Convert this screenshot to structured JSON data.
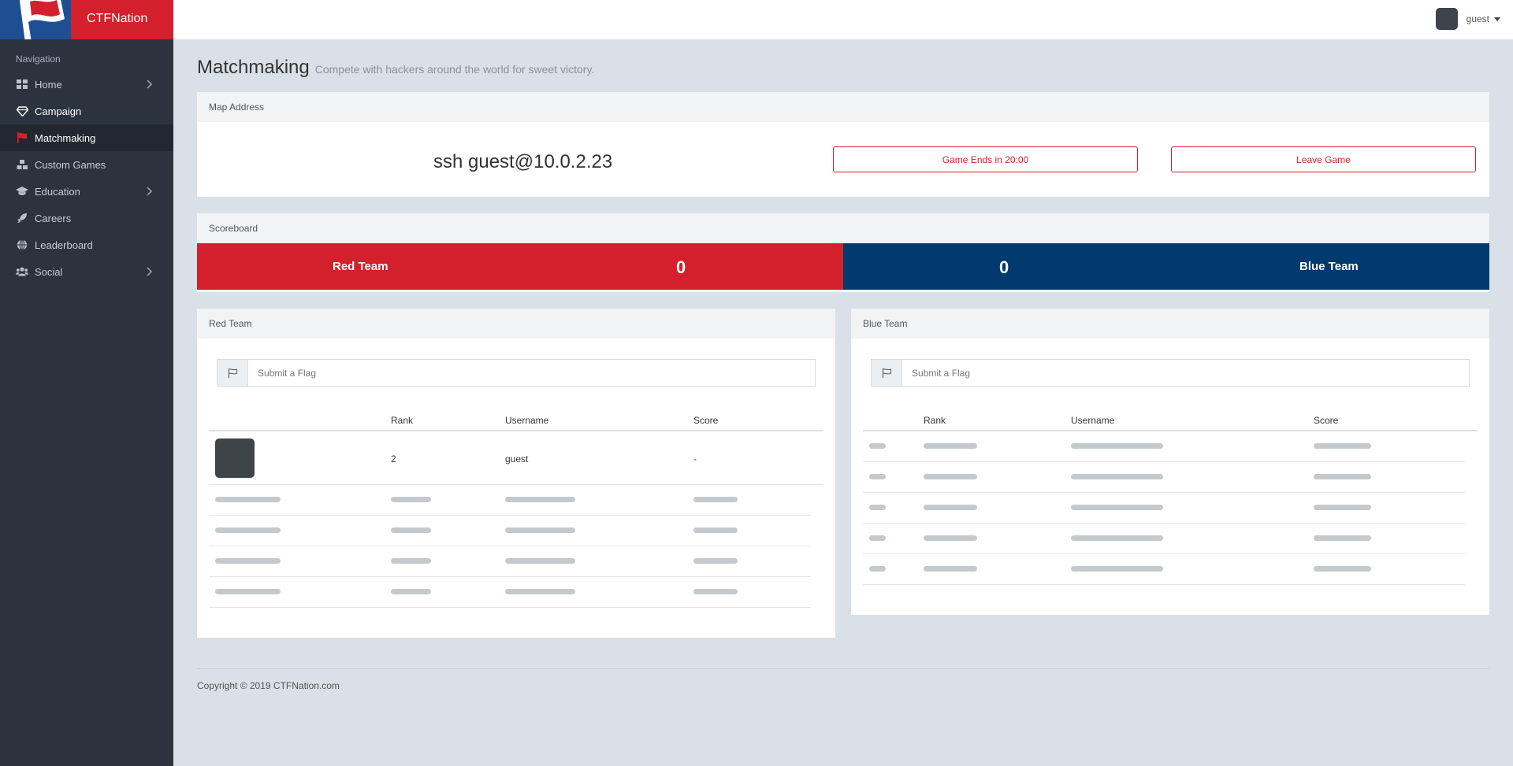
{
  "app": {
    "brand": "CTFNation"
  },
  "topbar": {
    "username": "guest"
  },
  "sidebar": {
    "heading": "Navigation",
    "items": [
      {
        "label": "Home",
        "icon": "grid-icon",
        "chevron": true
      },
      {
        "label": "Campaign",
        "icon": "diamond-icon",
        "chevron": false
      },
      {
        "label": "Matchmaking",
        "icon": "flag-icon",
        "chevron": false,
        "active": true
      },
      {
        "label": "Custom Games",
        "icon": "cubes-icon",
        "chevron": false
      },
      {
        "label": "Education",
        "icon": "graduation-cap-icon",
        "chevron": true
      },
      {
        "label": "Careers",
        "icon": "rocket-icon",
        "chevron": false
      },
      {
        "label": "Leaderboard",
        "icon": "globe-icon",
        "chevron": false
      },
      {
        "label": "Social",
        "icon": "users-icon",
        "chevron": true
      }
    ]
  },
  "page": {
    "title": "Matchmaking",
    "subtitle": "Compete with hackers around the world for sweet victory."
  },
  "map_panel": {
    "heading": "Map Address",
    "address": "ssh guest@10.0.2.23",
    "timer_button": "Game Ends in 20:00",
    "leave_button": "Leave Game"
  },
  "scoreboard": {
    "heading": "Scoreboard",
    "red": {
      "name": "Red Team",
      "score": "0"
    },
    "blue": {
      "name": "Blue Team",
      "score": "0"
    }
  },
  "red_panel": {
    "heading": "Red Team",
    "flag_placeholder": "Submit a Flag",
    "columns": [
      "Rank",
      "Username",
      "Score"
    ],
    "rows": [
      {
        "rank": "2",
        "username": "guest",
        "score": "-"
      }
    ],
    "placeholder_rows": 4
  },
  "blue_panel": {
    "heading": "Blue Team",
    "flag_placeholder": "Submit a Flag",
    "columns": [
      "Rank",
      "Username",
      "Score"
    ],
    "placeholder_rows": 5
  },
  "footer": {
    "copyright": "Copyright © 2019 CTFNation.com"
  },
  "colors": {
    "red": "#d4202c",
    "blue": "#003a6e",
    "sidebar": "#2b333e"
  }
}
